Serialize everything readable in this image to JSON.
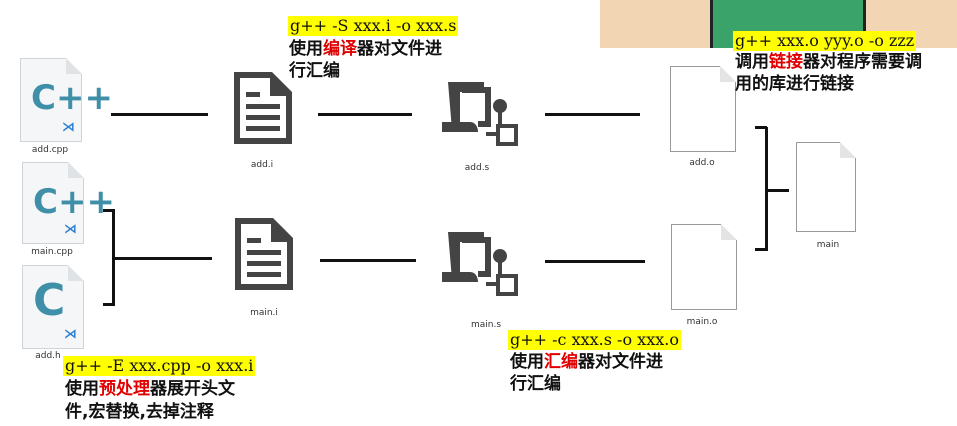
{
  "files": {
    "add_cpp": "add.cpp",
    "main_cpp": "main.cpp",
    "add_h": "add.h",
    "add_i": "add.i",
    "main_i": "main.i",
    "add_s": "add.s",
    "main_s": "main.s",
    "add_o": "add.o",
    "main_o": "main.o",
    "main": "main"
  },
  "icons": {
    "cpp": "C++",
    "c": "C",
    "vs": "vs-code-icon"
  },
  "preprocess": {
    "command": "g++ -E xxx.cpp -o xxx.i",
    "line1_pre": "使用",
    "line1_red": "预处理",
    "line1_post": "器展开头文",
    "line2": "件,宏替换,去掉注释"
  },
  "compile": {
    "command": "g++ -S xxx.i -o xxx.s",
    "line1_pre": "使用",
    "line1_red": "编译",
    "line1_post": "器对文件进",
    "line2": "行汇编"
  },
  "assemble": {
    "command": "g++ -c xxx.s -o xxx.o",
    "line1_pre": "使用",
    "line1_red": "汇编",
    "line1_post": "器对文件进",
    "line2": "行汇编"
  },
  "link": {
    "command": "g++ xxx.o yyy.o -o zzz",
    "line1_pre": "调用",
    "line1_red": "链接",
    "line1_post": "器对程序需要调",
    "line2": "用的库进行链接"
  },
  "colors": {
    "highlight": "#ffff00",
    "red": "#e00000"
  }
}
